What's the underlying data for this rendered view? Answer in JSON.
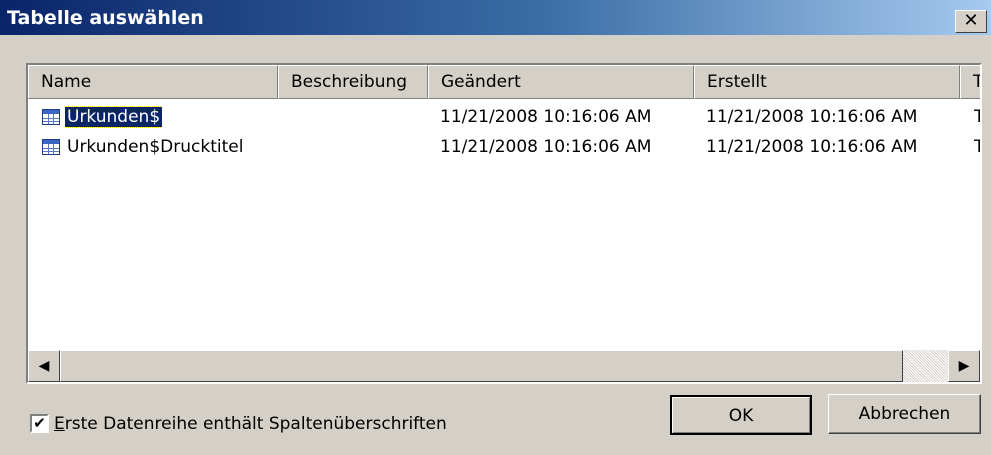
{
  "dialog": {
    "title": "Tabelle auswählen",
    "close_label": "✕"
  },
  "listview": {
    "columns": [
      "Name",
      "Beschreibung",
      "Geändert",
      "Erstellt",
      "T"
    ],
    "rows": [
      {
        "name": "Urkunden$",
        "description": "",
        "modified": "11/21/2008 10:16:06 AM",
        "created": "11/21/2008 10:16:06 AM",
        "type": "T",
        "selected": true,
        "icon": "table-icon"
      },
      {
        "name": "Urkunden$Drucktitel",
        "description": "",
        "modified": "11/21/2008 10:16:06 AM",
        "created": "11/21/2008 10:16:06 AM",
        "type": "T",
        "selected": false,
        "icon": "table-icon"
      }
    ]
  },
  "scrollbar": {
    "left_arrow": "◀",
    "right_arrow": "▶"
  },
  "options": {
    "header_row_checkbox": {
      "checked": true,
      "mnemonic": "E",
      "label_rest": "rste Datenreihe enthält Spaltenüberschriften",
      "check_glyph": "✔"
    }
  },
  "buttons": {
    "ok": "OK",
    "cancel": "Abbrechen"
  },
  "colors": {
    "title_bar_start": "#0a246a",
    "title_bar_end": "#a6caf0",
    "dialog_face": "#d4d0c8",
    "selection": "#0a246a"
  }
}
